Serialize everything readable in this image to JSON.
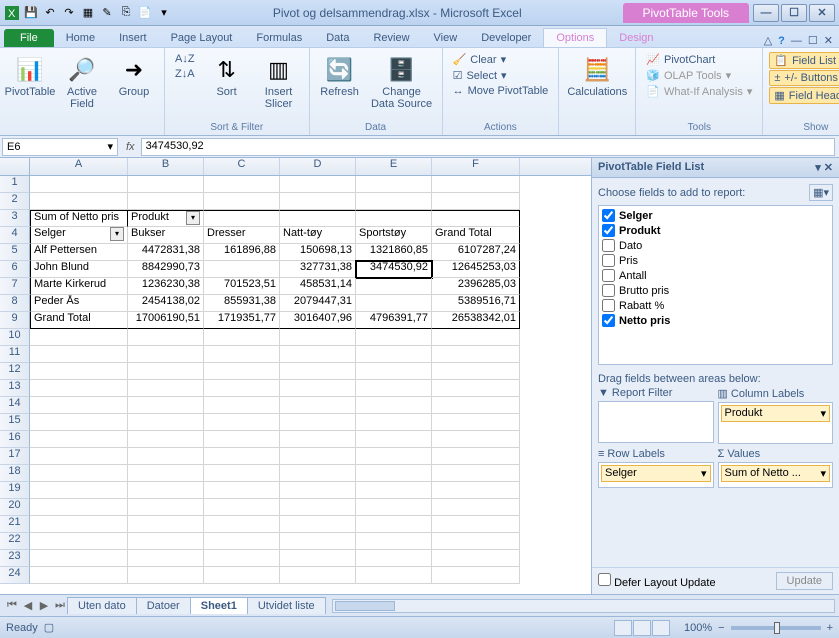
{
  "titlebar": {
    "title": "Pivot og delsammendrag.xlsx - Microsoft Excel",
    "pivot_tools": "PivotTable Tools"
  },
  "tabs": {
    "file": "File",
    "home": "Home",
    "insert": "Insert",
    "page_layout": "Page Layout",
    "formulas": "Formulas",
    "data": "Data",
    "review": "Review",
    "view": "View",
    "developer": "Developer",
    "options": "Options",
    "design": "Design"
  },
  "ribbon": {
    "pivottable": "PivotTable",
    "active_field": "Active\nField",
    "group": "Group",
    "sort": "Sort",
    "insert_slicer": "Insert\nSlicer",
    "refresh": "Refresh",
    "change_data_source": "Change Data\nSource",
    "clear": "Clear",
    "select": "Select",
    "move": "Move PivotTable",
    "calculations": "Calculations",
    "pivotchart": "PivotChart",
    "olap": "OLAP Tools",
    "whatif": "What-If Analysis",
    "field_list": "Field List",
    "pm_buttons": "+/- Buttons",
    "field_headers": "Field Headers",
    "groups": {
      "sort_filter": "Sort & Filter",
      "data": "Data",
      "actions": "Actions",
      "tools": "Tools",
      "show": "Show"
    }
  },
  "namebox": "E6",
  "formula": "3474530,92",
  "columns": [
    "A",
    "B",
    "C",
    "D",
    "E",
    "F"
  ],
  "rows": [
    "1",
    "2",
    "3",
    "4",
    "5",
    "6",
    "7",
    "8",
    "9",
    "10",
    "11",
    "12",
    "13",
    "14",
    "15",
    "16",
    "17",
    "18",
    "19",
    "20",
    "21",
    "22",
    "23",
    "24"
  ],
  "pivot": {
    "r3": {
      "A": "Sum of Netto pris",
      "B": "Produkt"
    },
    "r4": {
      "A": "Selger",
      "B": "Bukser",
      "C": "Dresser",
      "D": "Natt-tøy",
      "E": "Sportstøy",
      "F": "Grand Total"
    },
    "r5": {
      "A": "Alf Pettersen",
      "B": "4472831,38",
      "C": "161896,88",
      "D": "150698,13",
      "E": "1321860,85",
      "F": "6107287,24"
    },
    "r6": {
      "A": "John Blund",
      "B": "8842990,73",
      "C": "",
      "D": "327731,38",
      "E": "3474530,92",
      "F": "12645253,03"
    },
    "r7": {
      "A": "Marte Kirkerud",
      "B": "1236230,38",
      "C": "701523,51",
      "D": "458531,14",
      "E": "",
      "F": "2396285,03"
    },
    "r8": {
      "A": "Peder Ås",
      "B": "2454138,02",
      "C": "855931,38",
      "D": "2079447,31",
      "E": "",
      "F": "5389516,71"
    },
    "r9": {
      "A": "Grand Total",
      "B": "17006190,51",
      "C": "1719351,77",
      "D": "3016407,96",
      "E": "4796391,77",
      "F": "26538342,01"
    }
  },
  "fieldlist": {
    "title": "PivotTable Field List",
    "choose": "Choose fields to add to report:",
    "fields": [
      {
        "name": "Selger",
        "checked": true,
        "bold": true
      },
      {
        "name": "Produkt",
        "checked": true,
        "bold": true
      },
      {
        "name": "Dato",
        "checked": false
      },
      {
        "name": "Pris",
        "checked": false
      },
      {
        "name": "Antall",
        "checked": false
      },
      {
        "name": "Brutto pris",
        "checked": false
      },
      {
        "name": "Rabatt %",
        "checked": false
      },
      {
        "name": "Netto pris",
        "checked": true,
        "bold": true
      }
    ],
    "drag": "Drag fields between areas below:",
    "report_filter": "Report Filter",
    "column_labels": "Column Labels",
    "row_labels": "Row Labels",
    "values": "Values",
    "col_chip": "Produkt",
    "row_chip": "Selger",
    "val_chip": "Sum of Netto ...",
    "defer": "Defer Layout Update",
    "update": "Update"
  },
  "sheets": {
    "nav": "",
    "s1": "Uten dato",
    "s2": "Datoer",
    "s3": "Sheet1",
    "s4": "Utvidet liste"
  },
  "status": {
    "ready": "Ready",
    "zoom": "100%"
  },
  "chart_data": {
    "type": "table",
    "title": "Sum of Netto pris",
    "row_field": "Selger",
    "col_field": "Produkt",
    "columns": [
      "Bukser",
      "Dresser",
      "Natt-tøy",
      "Sportstøy",
      "Grand Total"
    ],
    "rows": [
      {
        "Selger": "Alf Pettersen",
        "Bukser": 4472831.38,
        "Dresser": 161896.88,
        "Natt-tøy": 150698.13,
        "Sportstøy": 1321860.85,
        "Grand Total": 6107287.24
      },
      {
        "Selger": "John Blund",
        "Bukser": 8842990.73,
        "Dresser": null,
        "Natt-tøy": 327731.38,
        "Sportstøy": 3474530.92,
        "Grand Total": 12645253.03
      },
      {
        "Selger": "Marte Kirkerud",
        "Bukser": 1236230.38,
        "Dresser": 701523.51,
        "Natt-tøy": 458531.14,
        "Sportstøy": null,
        "Grand Total": 2396285.03
      },
      {
        "Selger": "Peder Ås",
        "Bukser": 2454138.02,
        "Dresser": 855931.38,
        "Natt-tøy": 2079447.31,
        "Sportstøy": null,
        "Grand Total": 5389516.71
      },
      {
        "Selger": "Grand Total",
        "Bukser": 17006190.51,
        "Dresser": 1719351.77,
        "Natt-tøy": 3016407.96,
        "Sportstøy": 4796391.77,
        "Grand Total": 26538342.01
      }
    ]
  }
}
